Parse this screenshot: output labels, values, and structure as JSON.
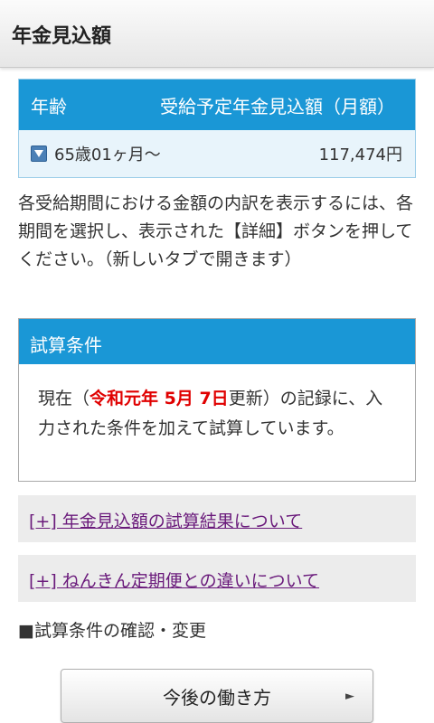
{
  "header": {
    "title": "年金見込額"
  },
  "pension_table": {
    "col_age": "年齢",
    "col_amount": "受給予定年金見込額（月額）",
    "rows": [
      {
        "age": "65歳01ヶ月〜",
        "amount": "117,474円"
      }
    ]
  },
  "info_text": "各受給期間における金額の内訳を表示するには、各期間を選択し、表示された【詳細】ボタンを押してください。（新しいタブで開きます）",
  "conditions": {
    "title": "試算条件",
    "text_before": "現在（",
    "date": "令和元年 5月 7日",
    "text_after": "更新）の記録に、入力された条件を加えて試算しています。"
  },
  "links": {
    "link1": "[+] 年金見込額の試算結果について",
    "link2": "[+] ねんきん定期便との違いについて"
  },
  "section_label": "■試算条件の確認・変更",
  "work_button": {
    "label": "今後の働き方",
    "arrow": "►"
  },
  "colors": {
    "accent_blue": "#1a97d6",
    "row_bg": "#e8f4fb",
    "link_purple": "#6a1a7b",
    "date_red": "#e00000"
  }
}
